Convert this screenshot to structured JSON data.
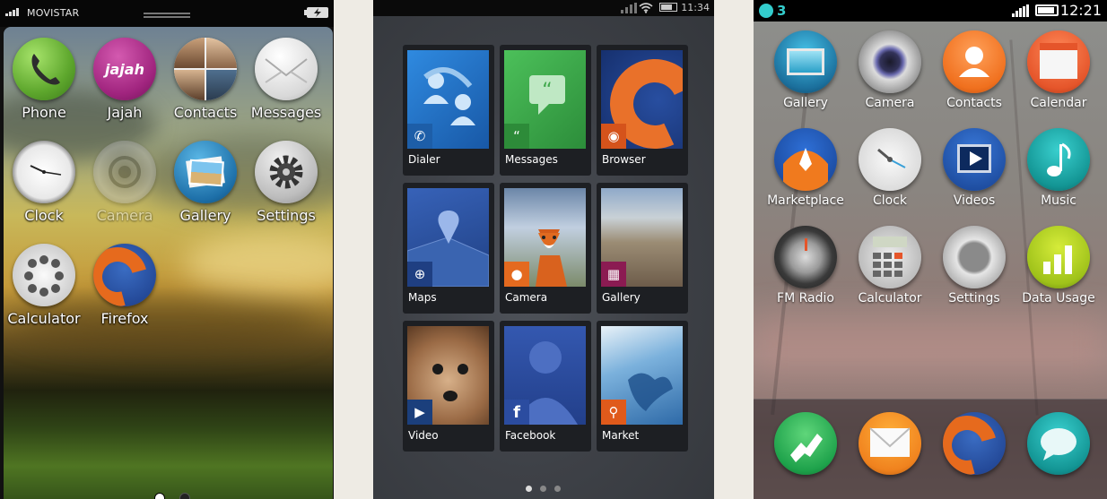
{
  "phone1": {
    "status_bar": {
      "carrier": "MOVISTAR"
    },
    "apps": [
      {
        "label": "Phone",
        "icon": "phone-icon"
      },
      {
        "label": "Jajah",
        "icon": "jajah-icon",
        "icon_text": "jajah"
      },
      {
        "label": "Contacts",
        "icon": "contacts-icon"
      },
      {
        "label": "Messages",
        "icon": "envelope-icon"
      },
      {
        "label": "Clock",
        "icon": "clock-icon"
      },
      {
        "label": "Camera",
        "icon": "camera-icon"
      },
      {
        "label": "Gallery",
        "icon": "gallery-icon"
      },
      {
        "label": "Settings",
        "icon": "gear-icon"
      },
      {
        "label": "Calculator",
        "icon": "calculator-icon"
      },
      {
        "label": "Firefox",
        "icon": "firefox-icon"
      }
    ],
    "page_count": 2,
    "current_page": 1
  },
  "phone2": {
    "status_bar": {
      "time": "11:34"
    },
    "tiles": [
      {
        "label": "Dialer",
        "icon": "phone-icon",
        "color": "#1b6fc2"
      },
      {
        "label": "Messages",
        "icon": "quote-icon",
        "color": "#3fa84b"
      },
      {
        "label": "Browser",
        "icon": "firefox-icon",
        "color": "#d5531b"
      },
      {
        "label": "Maps",
        "icon": "target-icon",
        "color": "#2b4f9c"
      },
      {
        "label": "Camera",
        "icon": "camera-icon",
        "color": "#e46a1f"
      },
      {
        "label": "Gallery",
        "icon": "grid-icon",
        "color": "#8b1b52"
      },
      {
        "label": "Video",
        "icon": "video-camera-icon",
        "color": "#1b3f7c"
      },
      {
        "label": "Facebook",
        "icon": "facebook-icon",
        "color": "#2b4ca0"
      },
      {
        "label": "Market",
        "icon": "search-icon",
        "color": "#e05a1b"
      }
    ],
    "page_count": 3
  },
  "phone3": {
    "status_bar": {
      "notification_count": "3",
      "time": "12:21"
    },
    "apps": [
      {
        "label": "Gallery",
        "icon": "gallery-icon"
      },
      {
        "label": "Camera",
        "icon": "camera-lens-icon"
      },
      {
        "label": "Contacts",
        "icon": "contacts-icon"
      },
      {
        "label": "Calendar",
        "icon": "calendar-icon"
      },
      {
        "label": "Marketplace",
        "icon": "rocket-icon"
      },
      {
        "label": "Clock",
        "icon": "clock-icon"
      },
      {
        "label": "Videos",
        "icon": "video-icon"
      },
      {
        "label": "Music",
        "icon": "music-note-icon"
      },
      {
        "label": "FM Radio",
        "icon": "radio-dial-icon"
      },
      {
        "label": "Calculator",
        "icon": "calculator-icon"
      },
      {
        "label": "Settings",
        "icon": "gear-icon"
      },
      {
        "label": "Data Usage",
        "icon": "bar-chart-icon"
      }
    ],
    "dock": [
      {
        "icon": "phone-icon"
      },
      {
        "icon": "envelope-icon"
      },
      {
        "icon": "firefox-icon"
      },
      {
        "icon": "speech-bubble-icon"
      }
    ]
  }
}
